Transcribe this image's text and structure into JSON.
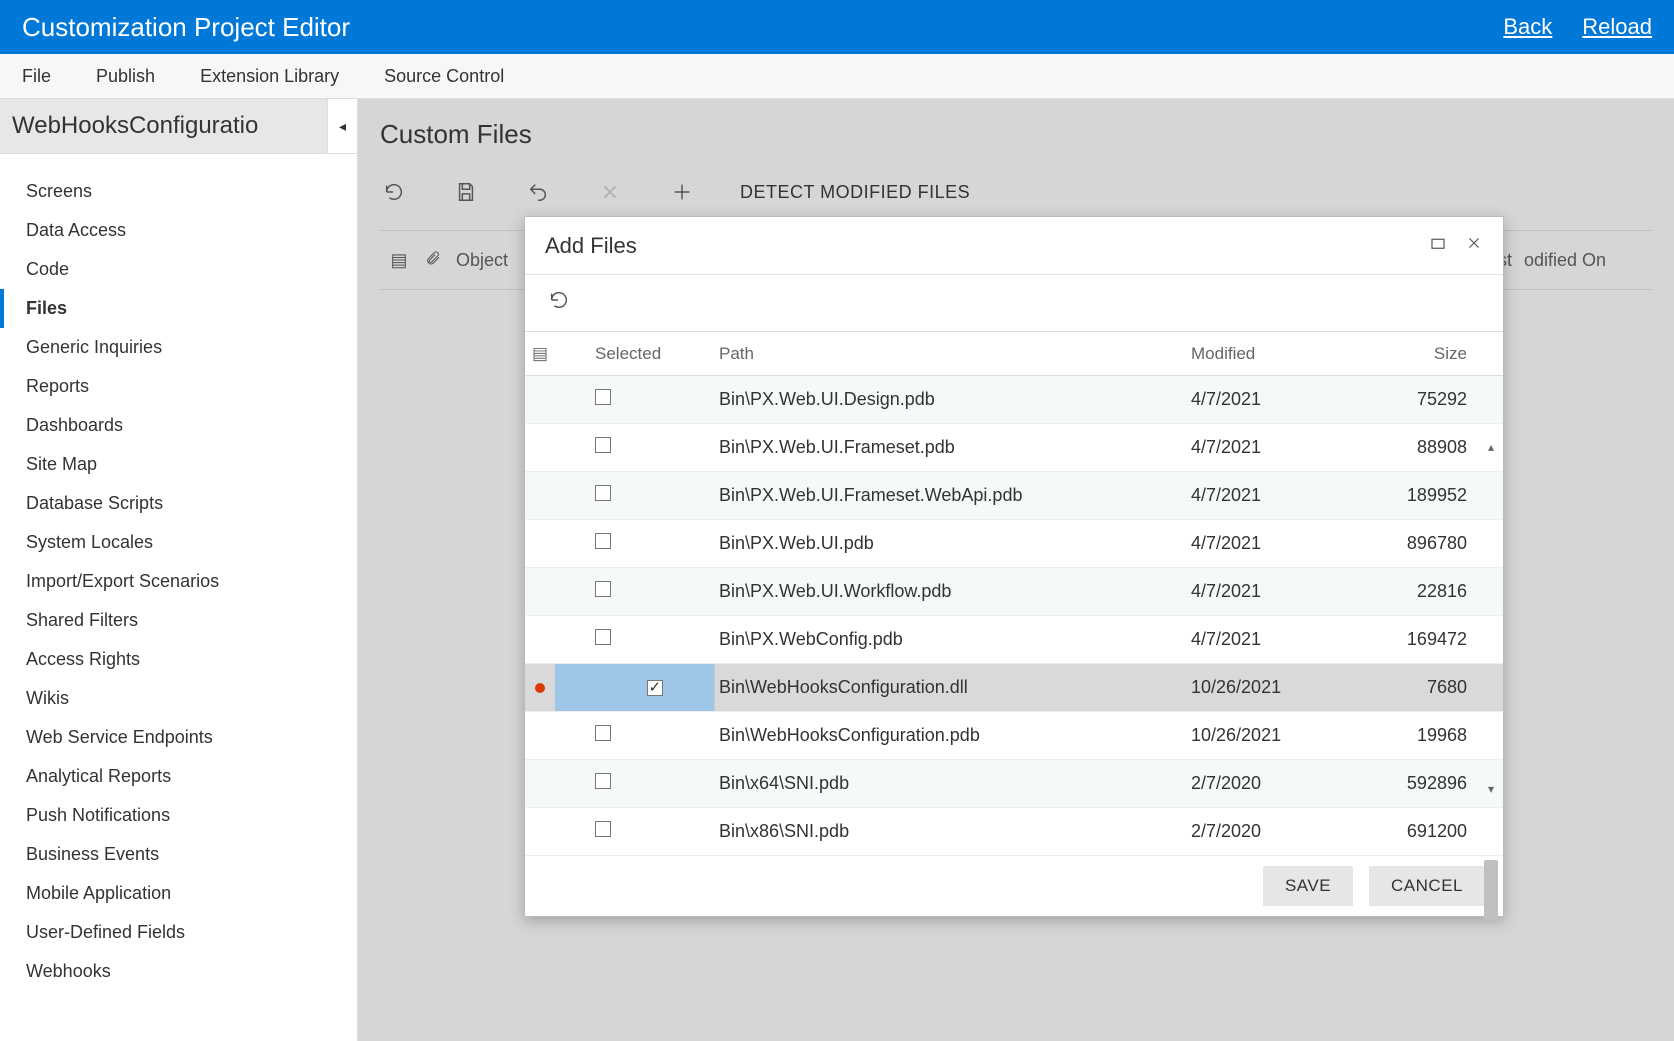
{
  "header": {
    "title": "Customization Project Editor",
    "back": "Back",
    "reload": "Reload"
  },
  "menu": {
    "file": "File",
    "publish": "Publish",
    "extension_library": "Extension Library",
    "source_control": "Source Control"
  },
  "sidebar": {
    "title": "WebHooksConfiguratio",
    "items": [
      "Screens",
      "Data Access",
      "Code",
      "Files",
      "Generic Inquiries",
      "Reports",
      "Dashboards",
      "Site Map",
      "Database Scripts",
      "System Locales",
      "Import/Export Scenarios",
      "Shared Filters",
      "Access Rights",
      "Wikis",
      "Web Service Endpoints",
      "Analytical Reports",
      "Push Notifications",
      "Business Events",
      "Mobile Application",
      "User-Defined Fields",
      "Webhooks"
    ],
    "active_index": 3
  },
  "content": {
    "title": "Custom Files",
    "toolbar": {
      "detect": "DETECT MODIFIED FILES"
    },
    "bg_header": {
      "object": "Object",
      "last": "ast",
      "modified_on": "odified On"
    }
  },
  "dialog": {
    "title": "Add Files",
    "columns": {
      "selected": "Selected",
      "path": "Path",
      "modified": "Modified",
      "size": "Size"
    },
    "rows": [
      {
        "selected": false,
        "path": "Bin\\PX.Web.UI.Design.pdb",
        "modified": "4/7/2021",
        "size": "75292",
        "ind": ""
      },
      {
        "selected": false,
        "path": "Bin\\PX.Web.UI.Frameset.pdb",
        "modified": "4/7/2021",
        "size": "88908",
        "ind": ""
      },
      {
        "selected": false,
        "path": "Bin\\PX.Web.UI.Frameset.WebApi.pdb",
        "modified": "4/7/2021",
        "size": "189952",
        "ind": ""
      },
      {
        "selected": false,
        "path": "Bin\\PX.Web.UI.pdb",
        "modified": "4/7/2021",
        "size": "896780",
        "ind": ""
      },
      {
        "selected": false,
        "path": "Bin\\PX.Web.UI.Workflow.pdb",
        "modified": "4/7/2021",
        "size": "22816",
        "ind": ""
      },
      {
        "selected": false,
        "path": "Bin\\PX.WebConfig.pdb",
        "modified": "4/7/2021",
        "size": "169472",
        "ind": ""
      },
      {
        "selected": true,
        "path": "Bin\\WebHooksConfiguration.dll",
        "modified": "10/26/2021",
        "size": "7680",
        "ind": "dot"
      },
      {
        "selected": false,
        "path": "Bin\\WebHooksConfiguration.pdb",
        "modified": "10/26/2021",
        "size": "19968",
        "ind": ""
      },
      {
        "selected": false,
        "path": "Bin\\x64\\SNI.pdb",
        "modified": "2/7/2020",
        "size": "592896",
        "ind": ""
      },
      {
        "selected": false,
        "path": "Bin\\x86\\SNI.pdb",
        "modified": "2/7/2020",
        "size": "691200",
        "ind": ""
      }
    ],
    "footer": {
      "save": "SAVE",
      "cancel": "CANCEL"
    }
  }
}
